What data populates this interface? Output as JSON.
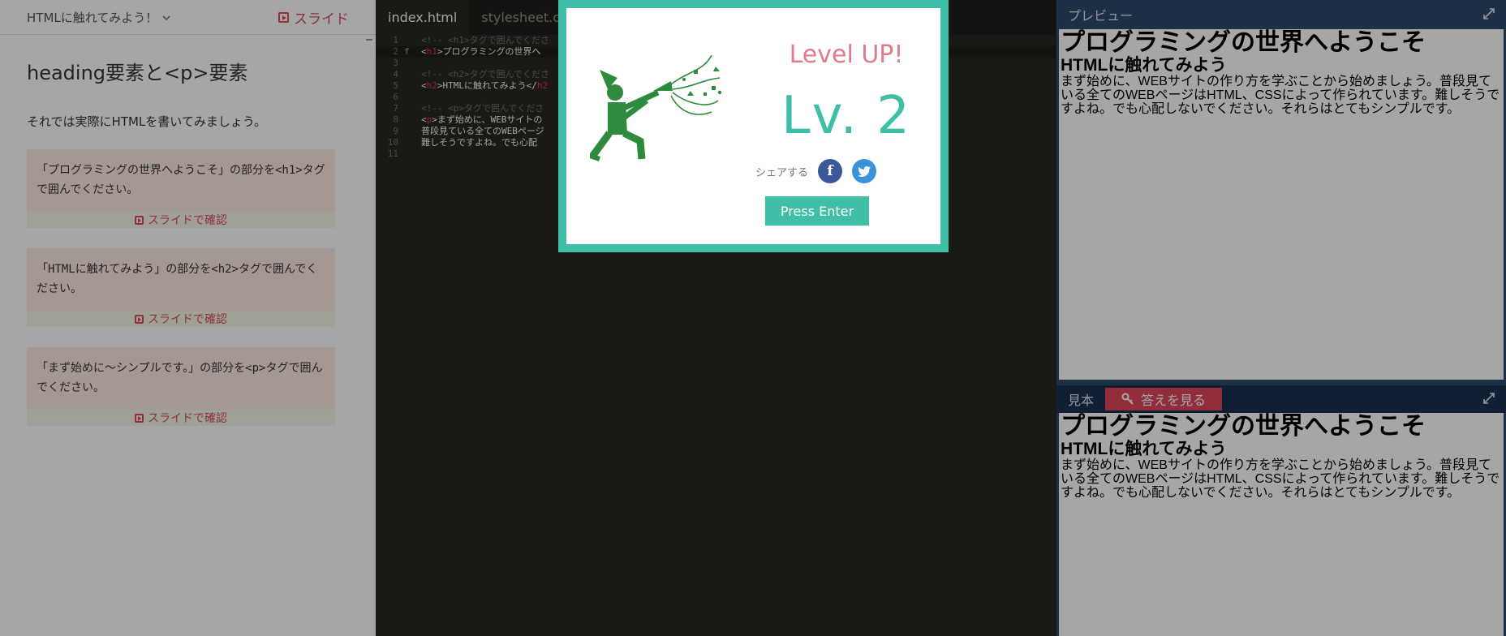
{
  "left": {
    "course_title": "HTMLに触れてみよう！",
    "slide_label": "スライド",
    "lesson_title": "heading要素と<p>要素",
    "intro": "それでは実際にHTMLを書いてみましょう。",
    "tasks": [
      {
        "text": "「プログラミングの世界へようこそ」の部分を<h1>タグで囲んでください。",
        "confirm": "スライドで確認"
      },
      {
        "text": "「HTMLに触れてみよう」の部分を<h2>タグで囲んでください。",
        "confirm": "スライドで確認"
      },
      {
        "text": "「まず始めに～シンプルです。」の部分を<p>タグで囲んでください。",
        "confirm": "スライドで確認"
      }
    ]
  },
  "editor": {
    "tabs": [
      "index.html",
      "stylesheet.css"
    ],
    "lines": [
      {
        "n": "1",
        "g": "",
        "parts": [
          {
            "t": "<!-- <h1>タグで囲んでくださ",
            "c": "cm"
          }
        ]
      },
      {
        "n": "2",
        "g": "f",
        "parts": [
          {
            "t": "<",
            "c": ""
          },
          {
            "t": "h1",
            "c": "tg"
          },
          {
            "t": ">プログラミングの世界へ",
            "c": ""
          }
        ]
      },
      {
        "n": "3",
        "g": "",
        "parts": []
      },
      {
        "n": "4",
        "g": "",
        "parts": [
          {
            "t": "<!-- <h2>タグで囲んでくださ",
            "c": "cm"
          }
        ]
      },
      {
        "n": "5",
        "g": "",
        "parts": [
          {
            "t": "<",
            "c": ""
          },
          {
            "t": "h2",
            "c": "tg"
          },
          {
            "t": ">HTMLに触れてみよう</",
            "c": ""
          },
          {
            "t": "h2",
            "c": "tg"
          }
        ]
      },
      {
        "n": "6",
        "g": "",
        "parts": []
      },
      {
        "n": "7",
        "g": "",
        "parts": [
          {
            "t": "<!-- <p>タグで囲んでくださ",
            "c": "cm"
          }
        ]
      },
      {
        "n": "8",
        "g": "",
        "parts": [
          {
            "t": "<",
            "c": ""
          },
          {
            "t": "p",
            "c": "tg"
          },
          {
            "t": ">まず始めに、WEBサイトの",
            "c": ""
          }
        ]
      },
      {
        "n": "9",
        "g": "",
        "parts": [
          {
            "t": "普段見ている全てのWEBページ",
            "c": ""
          }
        ]
      },
      {
        "n": "10",
        "g": "",
        "parts": [
          {
            "t": "難しそうですよね。でも心配",
            "c": ""
          }
        ]
      },
      {
        "n": "11",
        "g": "",
        "parts": []
      }
    ]
  },
  "preview": {
    "title": "プレビュー",
    "h1": "プログラミングの世界へようこそ",
    "h2": "HTMLに触れてみよう",
    "p": "まず始めに、WEBサイトの作り方を学ぶことから始めましょう。普段見ている全てのWEBページはHTML、CSSによって作られています。難しそうですよね。でも心配しないでください。それらはとてもシンプルです。"
  },
  "sample": {
    "title": "見本",
    "answer_label": "答えを見る",
    "h1": "プログラミングの世界へようこそ",
    "h2": "HTMLに触れてみよう",
    "p": "まず始めに、WEBサイトの作り方を学ぶことから始めましょう。普段見ている全てのWEBページはHTML、CSSによって作られています。難しそうですよね。でも心配しないでください。それらはとてもシンプルです。"
  },
  "modal": {
    "heading": "Level UP!",
    "level": "Lv. 2",
    "share_label": "シェアする",
    "facebook_glyph": "f",
    "button": "Press Enter"
  },
  "colors": {
    "accent": "#3fbfa7",
    "danger": "#e0485c",
    "level_up_pink": "#e07c8a",
    "mascot_green": "#2e8b3e",
    "facebook": "#3b5998",
    "twitter": "#3a92d8"
  },
  "icons": [
    "play-icon",
    "chevron-down-icon",
    "cloud-upload-icon",
    "key-icon",
    "expand-icon",
    "facebook-icon",
    "twitter-icon",
    "party-mascot-icon"
  ]
}
